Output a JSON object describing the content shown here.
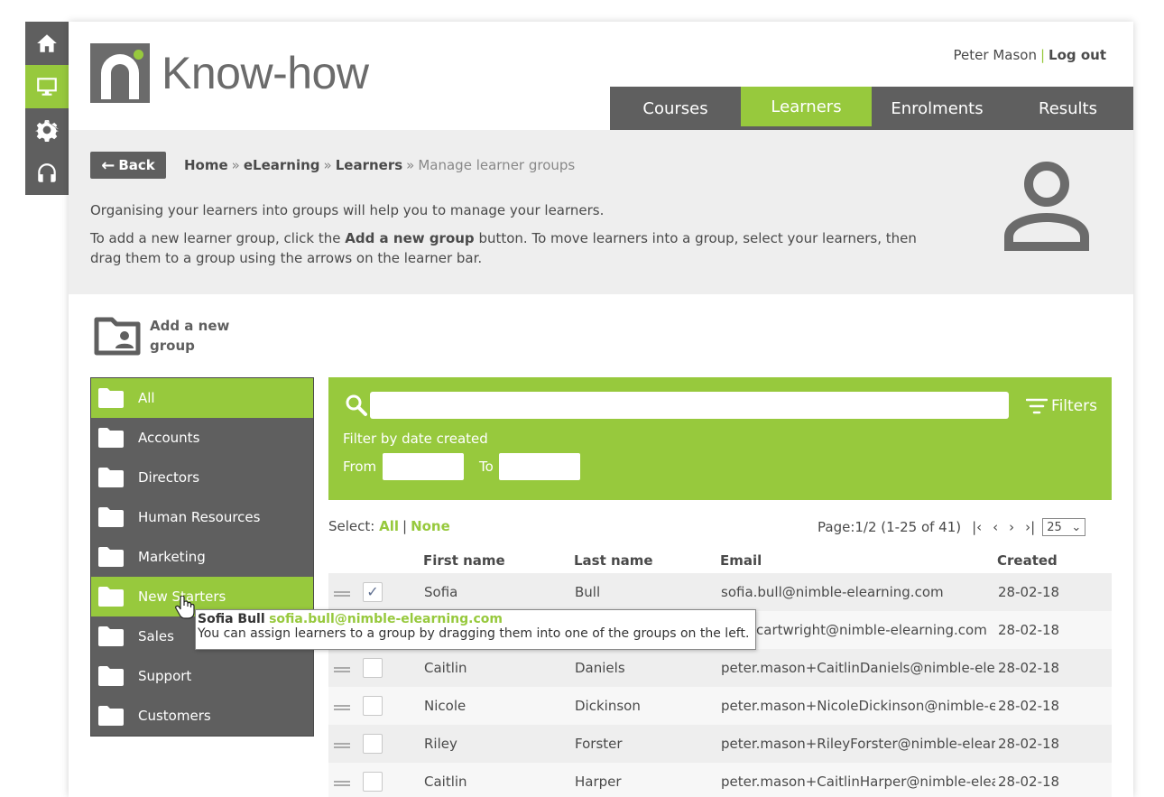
{
  "rail": [
    {
      "icon": "home-icon",
      "active": false
    },
    {
      "icon": "monitor-icon",
      "active": true
    },
    {
      "icon": "gear-icon",
      "active": false
    },
    {
      "icon": "headset-icon",
      "active": false
    }
  ],
  "header": {
    "logo_text": "Know-how",
    "user_name": "Peter Mason",
    "separator": "|",
    "logout": "Log out",
    "tabs": [
      {
        "label": "Courses"
      },
      {
        "label": "Learners"
      },
      {
        "label": "Enrolments"
      },
      {
        "label": "Results"
      }
    ]
  },
  "hero": {
    "back_label": "Back",
    "crumbs": [
      "Home",
      "eLearning",
      "Learners",
      "Manage learner groups"
    ],
    "crumb_sep": "»",
    "intro_1": "Organising your learners into groups will help you to manage your learners.",
    "intro_2a": "To add a new learner group, click the ",
    "intro_2b": "Add a new group",
    "intro_2c": " button. To move learners into a group, select your learners, then drag them to a group using the arrows on the learner bar."
  },
  "add_group": {
    "label_1": "Add a new",
    "label_2": "group"
  },
  "groups": [
    {
      "label": "All"
    },
    {
      "label": "Accounts"
    },
    {
      "label": "Directors"
    },
    {
      "label": "Human Resources"
    },
    {
      "label": "Marketing"
    },
    {
      "label": "New Starters"
    },
    {
      "label": "Sales"
    },
    {
      "label": "Support"
    },
    {
      "label": "Customers"
    }
  ],
  "search": {
    "filters_label": "Filters",
    "date_title": "Filter by date created",
    "from_label": "From",
    "to_label": "To"
  },
  "selection": {
    "label": "Select:",
    "all": "All",
    "sep": "|",
    "none": "None"
  },
  "pager": {
    "text": "Page:1/2 (1-25 of 41)",
    "first": "|‹",
    "prev": "‹",
    "next": "›",
    "last": "›|",
    "per_page": "25"
  },
  "table": {
    "headers": {
      "first": "First name",
      "last": "Last name",
      "email": "Email",
      "created": "Created"
    },
    "rows": [
      {
        "first": "Sofia",
        "last": "Bull",
        "email": "sofia.bull@nimble-elearning.com",
        "created": "28-02-18",
        "checked": "✓"
      },
      {
        "first": "",
        "last": "",
        "email": "cartwright@nimble-elearning.com",
        "created": "28-02-18",
        "checked": ""
      },
      {
        "first": "Caitlin",
        "last": "Daniels",
        "email": "peter.mason+CaitlinDaniels@nimble-ele",
        "created": "28-02-18",
        "checked": ""
      },
      {
        "first": "Nicole",
        "last": "Dickinson",
        "email": "peter.mason+NicoleDickinson@nimble-e",
        "created": "28-02-18",
        "checked": ""
      },
      {
        "first": "Riley",
        "last": "Forster",
        "email": "peter.mason+RileyForster@nimble-elear",
        "created": "28-02-18",
        "checked": ""
      },
      {
        "first": "Caitlin",
        "last": "Harper",
        "email": "peter.mason+CaitlinHarper@nimble-elea",
        "created": "28-02-18",
        "checked": ""
      }
    ]
  },
  "tooltip": {
    "name": "Sofia Bull",
    "email": "sofia.bull@nimble-elearning.com",
    "message": "You can assign learners to a group by dragging them into one of the groups on the left."
  },
  "colors": {
    "accent": "#97c93d",
    "dark": "#5f5f5f",
    "hero_bg": "#eeeeee"
  }
}
